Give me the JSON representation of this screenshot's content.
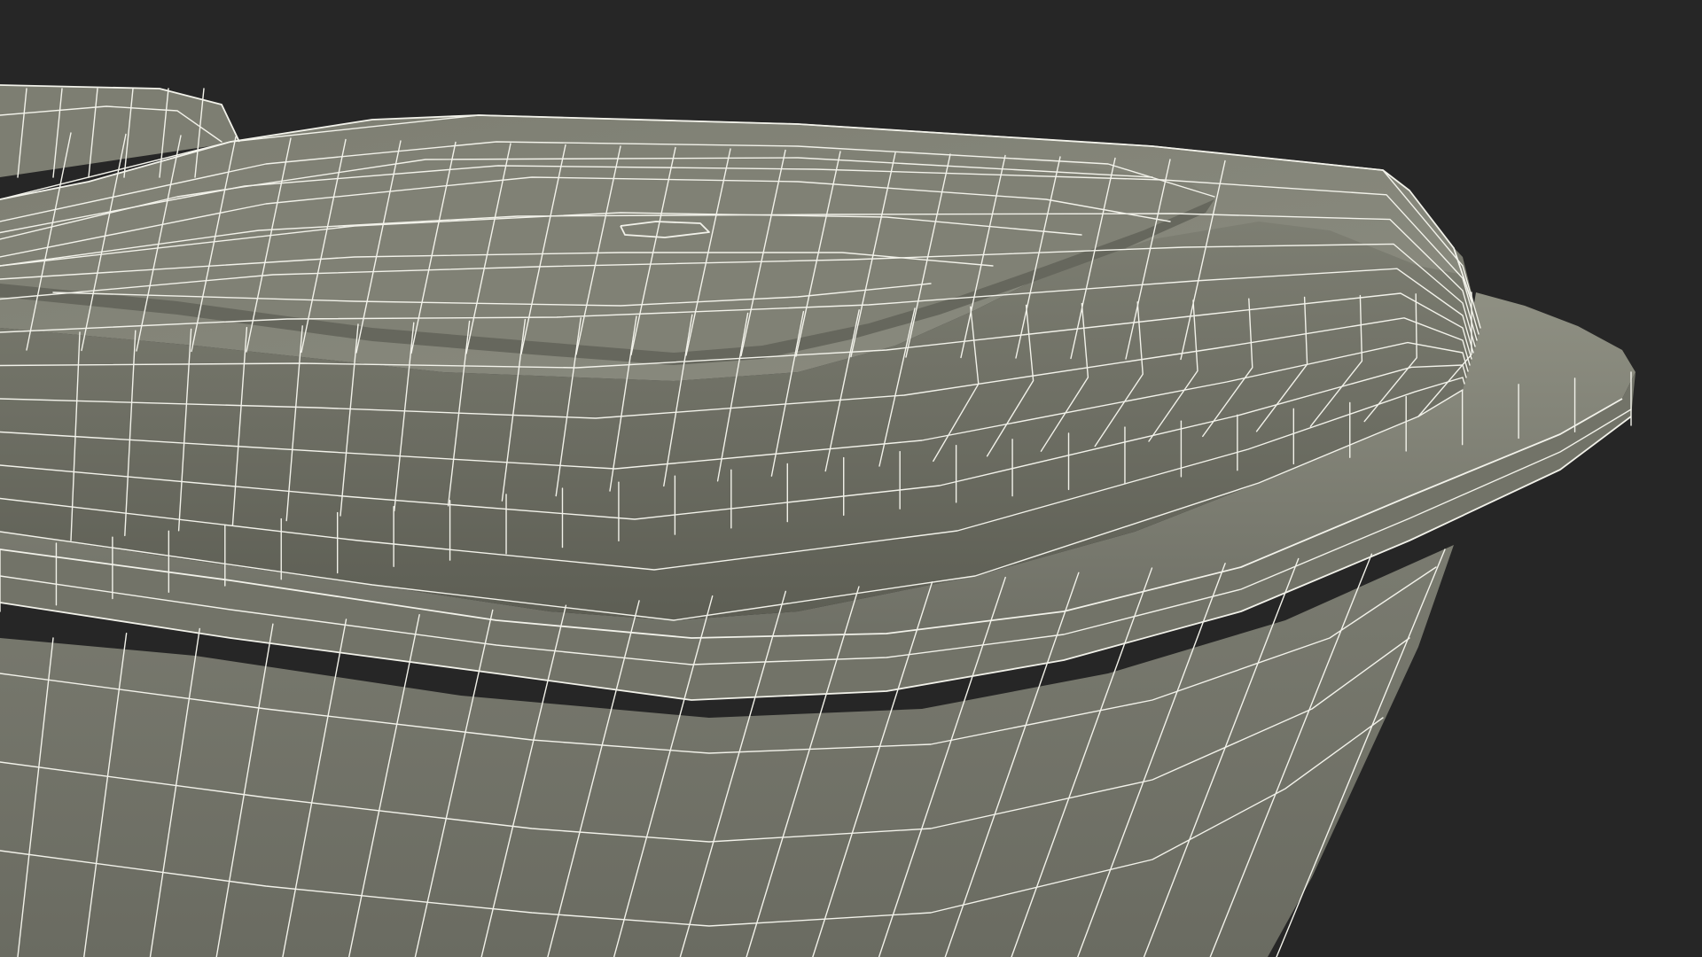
{
  "scene": {
    "subject": "wireframe-render",
    "colors": {
      "background": "#262626",
      "surface_light": "#8a8b7e",
      "surface_mid": "#7b7c70",
      "surface_dark": "#5f6056",
      "surface_shadow": "#54554c",
      "wire": "#f2f2ea"
    }
  }
}
